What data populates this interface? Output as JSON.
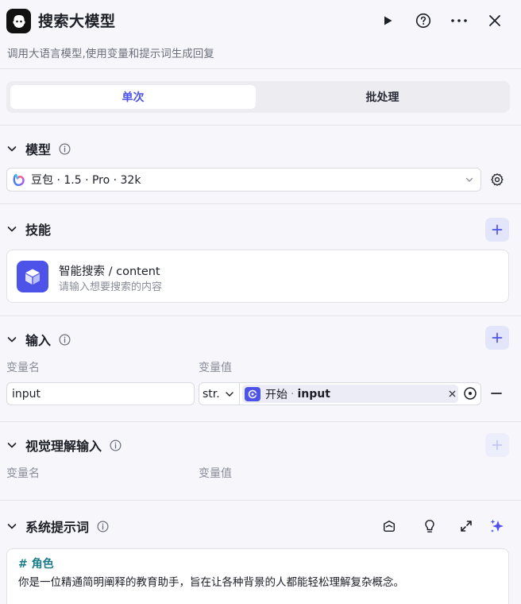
{
  "header": {
    "title": "搜索大模型",
    "subtitle": "调用大语言模型,使用变量和提示词生成回复",
    "actions": [
      "run-icon",
      "help-icon",
      "more-icon",
      "close-icon"
    ]
  },
  "mode_tabs": [
    {
      "label": "单次",
      "active": true
    },
    {
      "label": "批处理",
      "active": false
    }
  ],
  "model_section": {
    "label": "模型",
    "selected_model": "豆包 · 1.5 · Pro · 32k"
  },
  "skills_section": {
    "label": "技能",
    "skills": [
      {
        "name": "智能搜索 / content",
        "description": "请输入想要搜索的内容"
      }
    ]
  },
  "input_section": {
    "label": "输入",
    "col_name": "变量名",
    "col_value": "变量值",
    "rows": [
      {
        "name": "input",
        "type": "str.",
        "ref_source": "开始",
        "ref_separator": "·",
        "ref_var": "input"
      }
    ]
  },
  "vision_section": {
    "label": "视觉理解输入",
    "col_name": "变量名",
    "col_value": "变量值"
  },
  "system_prompt_section": {
    "label": "系统提示词",
    "content_heading": "# 角色",
    "content_text": "你是一位精通简明阐释的教育助手，旨在让各种背景的人都能轻松理解复杂概念。"
  },
  "colors": {
    "accent": "#4d53e8",
    "heading_teal": "#1a7c86",
    "background": "#f7f7fb"
  }
}
